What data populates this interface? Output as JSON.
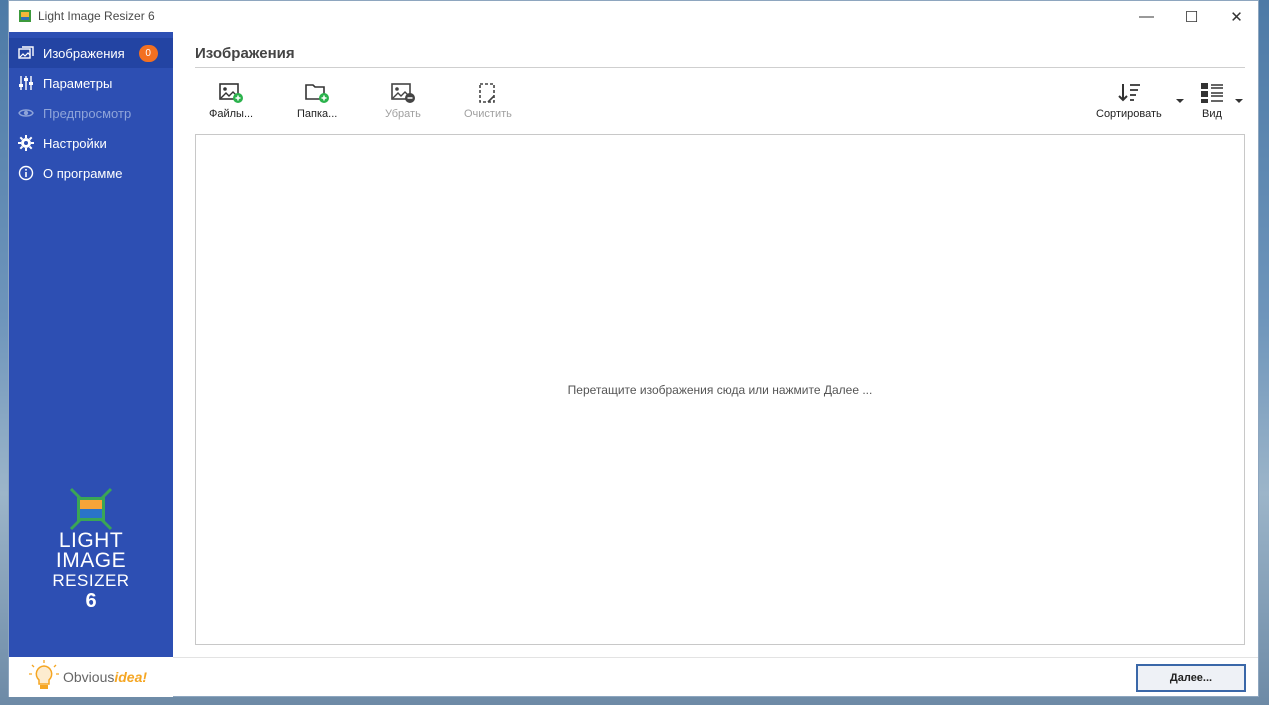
{
  "window": {
    "title": "Light Image Resizer 6",
    "minimize": "—",
    "maximize": "☐",
    "close": "✕"
  },
  "sidebar": {
    "items": [
      {
        "label": "Изображения",
        "icon": "images-icon",
        "badge": "0",
        "active": true
      },
      {
        "label": "Параметры",
        "icon": "sliders-icon"
      },
      {
        "label": "Предпросмотр",
        "icon": "eye-icon",
        "disabled": true
      },
      {
        "label": "Настройки",
        "icon": "gear-icon"
      },
      {
        "label": "О программе",
        "icon": "info-icon"
      }
    ],
    "logo": {
      "line1": "LIGHT",
      "line2": "IMAGE",
      "line3": "RESIZER",
      "line4": "6"
    },
    "brand": {
      "part1": "Obvious",
      "part2": "idea!"
    }
  },
  "main": {
    "title": "Изображения",
    "toolbar": {
      "files": "Файлы...",
      "folder": "Папка...",
      "remove": "Убрать",
      "clear": "Очистить",
      "sort": "Сортировать",
      "view": "Вид"
    },
    "drop_hint": "Перетащите изображения сюда или нажмите Далее ...",
    "next_button": "Далее..."
  },
  "colors": {
    "sidebar": "#2d4fb3",
    "badge": "#f37021",
    "accent_green": "#2bb24c",
    "brand_orange": "#f5a623"
  }
}
